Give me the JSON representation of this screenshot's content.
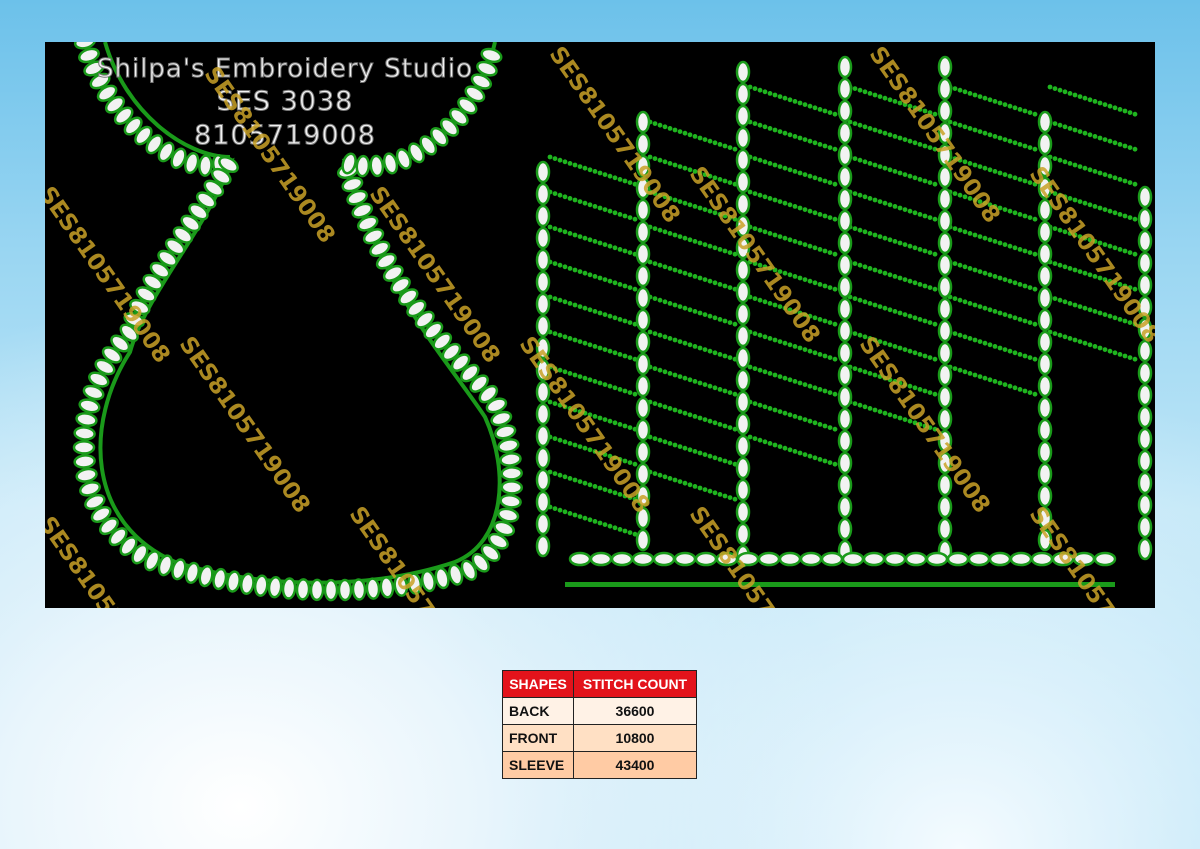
{
  "studio": {
    "name": "Shilpa's Embroidery Studio",
    "code": "SES 3038",
    "phone": "8105719008"
  },
  "watermark": "SES8105719008",
  "colors": {
    "canvas": "#000000",
    "outline": "#1a9a1a",
    "bead": "#f2f2f2",
    "header": "#e3131b"
  },
  "table": {
    "headers": [
      "SHAPES",
      "STITCH COUNT"
    ],
    "rows": [
      {
        "shape": "BACK",
        "count": "36600"
      },
      {
        "shape": "FRONT",
        "count": "10800"
      },
      {
        "shape": "SLEEVE",
        "count": "43400"
      }
    ]
  }
}
